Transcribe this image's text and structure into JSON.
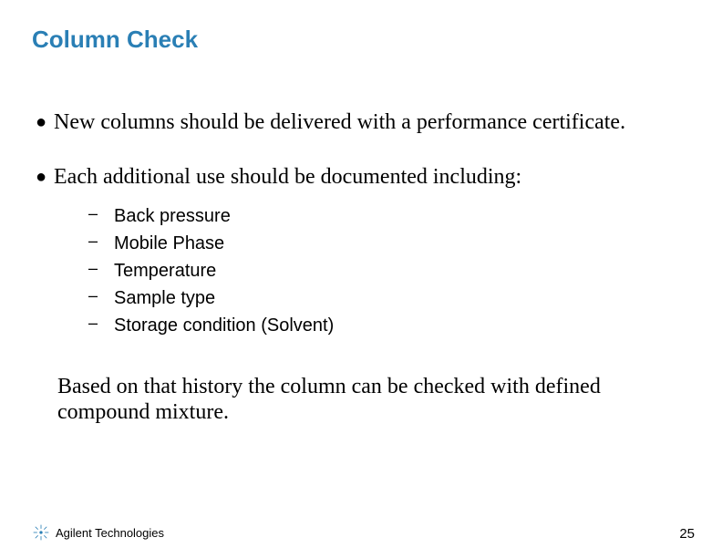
{
  "title": "Column Check",
  "bullets": [
    {
      "text": "New columns should be delivered with a performance certificate."
    },
    {
      "text": "Each additional use should be documented including:"
    }
  ],
  "sub_items": [
    "Back pressure",
    "Mobile Phase",
    "Temperature",
    "Sample type",
    "Storage condition (Solvent)"
  ],
  "closing": "Based on that history the column can be checked with defined compound mixture.",
  "footer": {
    "brand": "Agilent Technologies",
    "page": "25"
  }
}
